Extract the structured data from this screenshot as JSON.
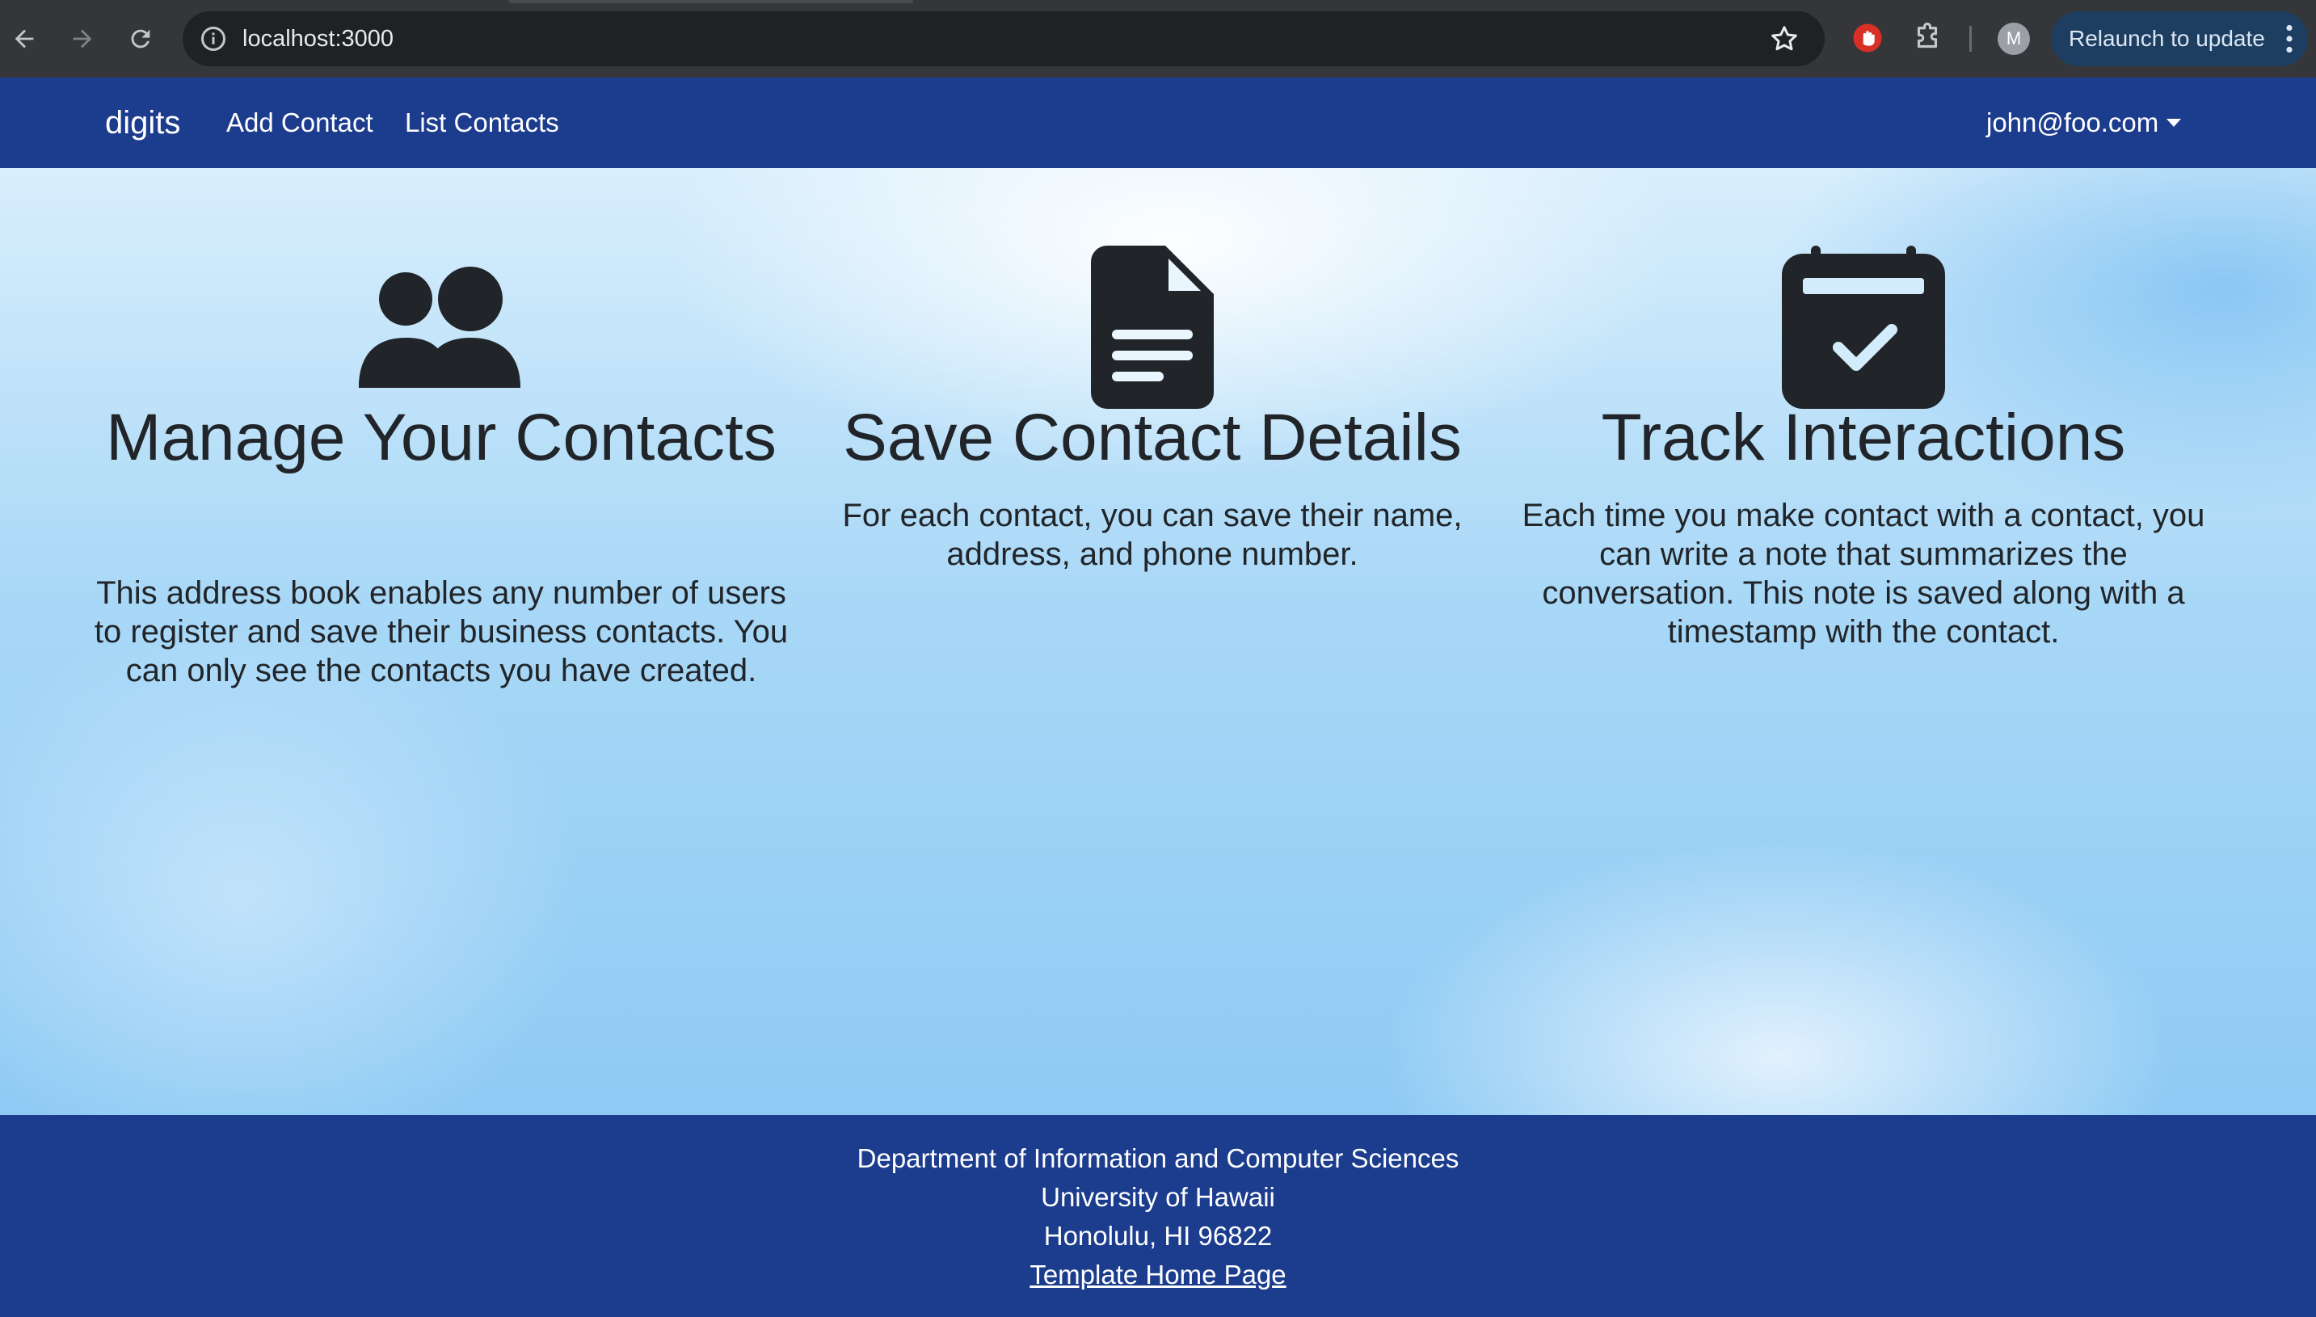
{
  "browser": {
    "url": "localhost:3000",
    "avatar_letter": "M",
    "relaunch_label": "Relaunch to update"
  },
  "navbar": {
    "brand": "digits",
    "links": [
      "Add Contact",
      "List Contacts"
    ],
    "user": "john@foo.com"
  },
  "features": [
    {
      "icon": "users-icon",
      "title": "Manage Your Contacts",
      "text": "This address book enables any number of users to register and save their business contacts. You can only see the contacts you have created."
    },
    {
      "icon": "file-icon",
      "title": "Save Contact Details",
      "text": "For each contact, you can save their name, address, and phone number."
    },
    {
      "icon": "calendar-check-icon",
      "title": "Track Interactions",
      "text": "Each time you make contact with a contact, you can write a note that summarizes the conversation. This note is saved along with a timestamp with the contact."
    }
  ],
  "footer": {
    "lines": [
      "Department of Information and Computer Sciences",
      "University of Hawaii",
      "Honolulu, HI 96822"
    ],
    "link": "Template Home Page"
  },
  "colors": {
    "navbar": "#1c3c8e",
    "text_dark": "#212529",
    "chrome_bg": "#35363a"
  }
}
